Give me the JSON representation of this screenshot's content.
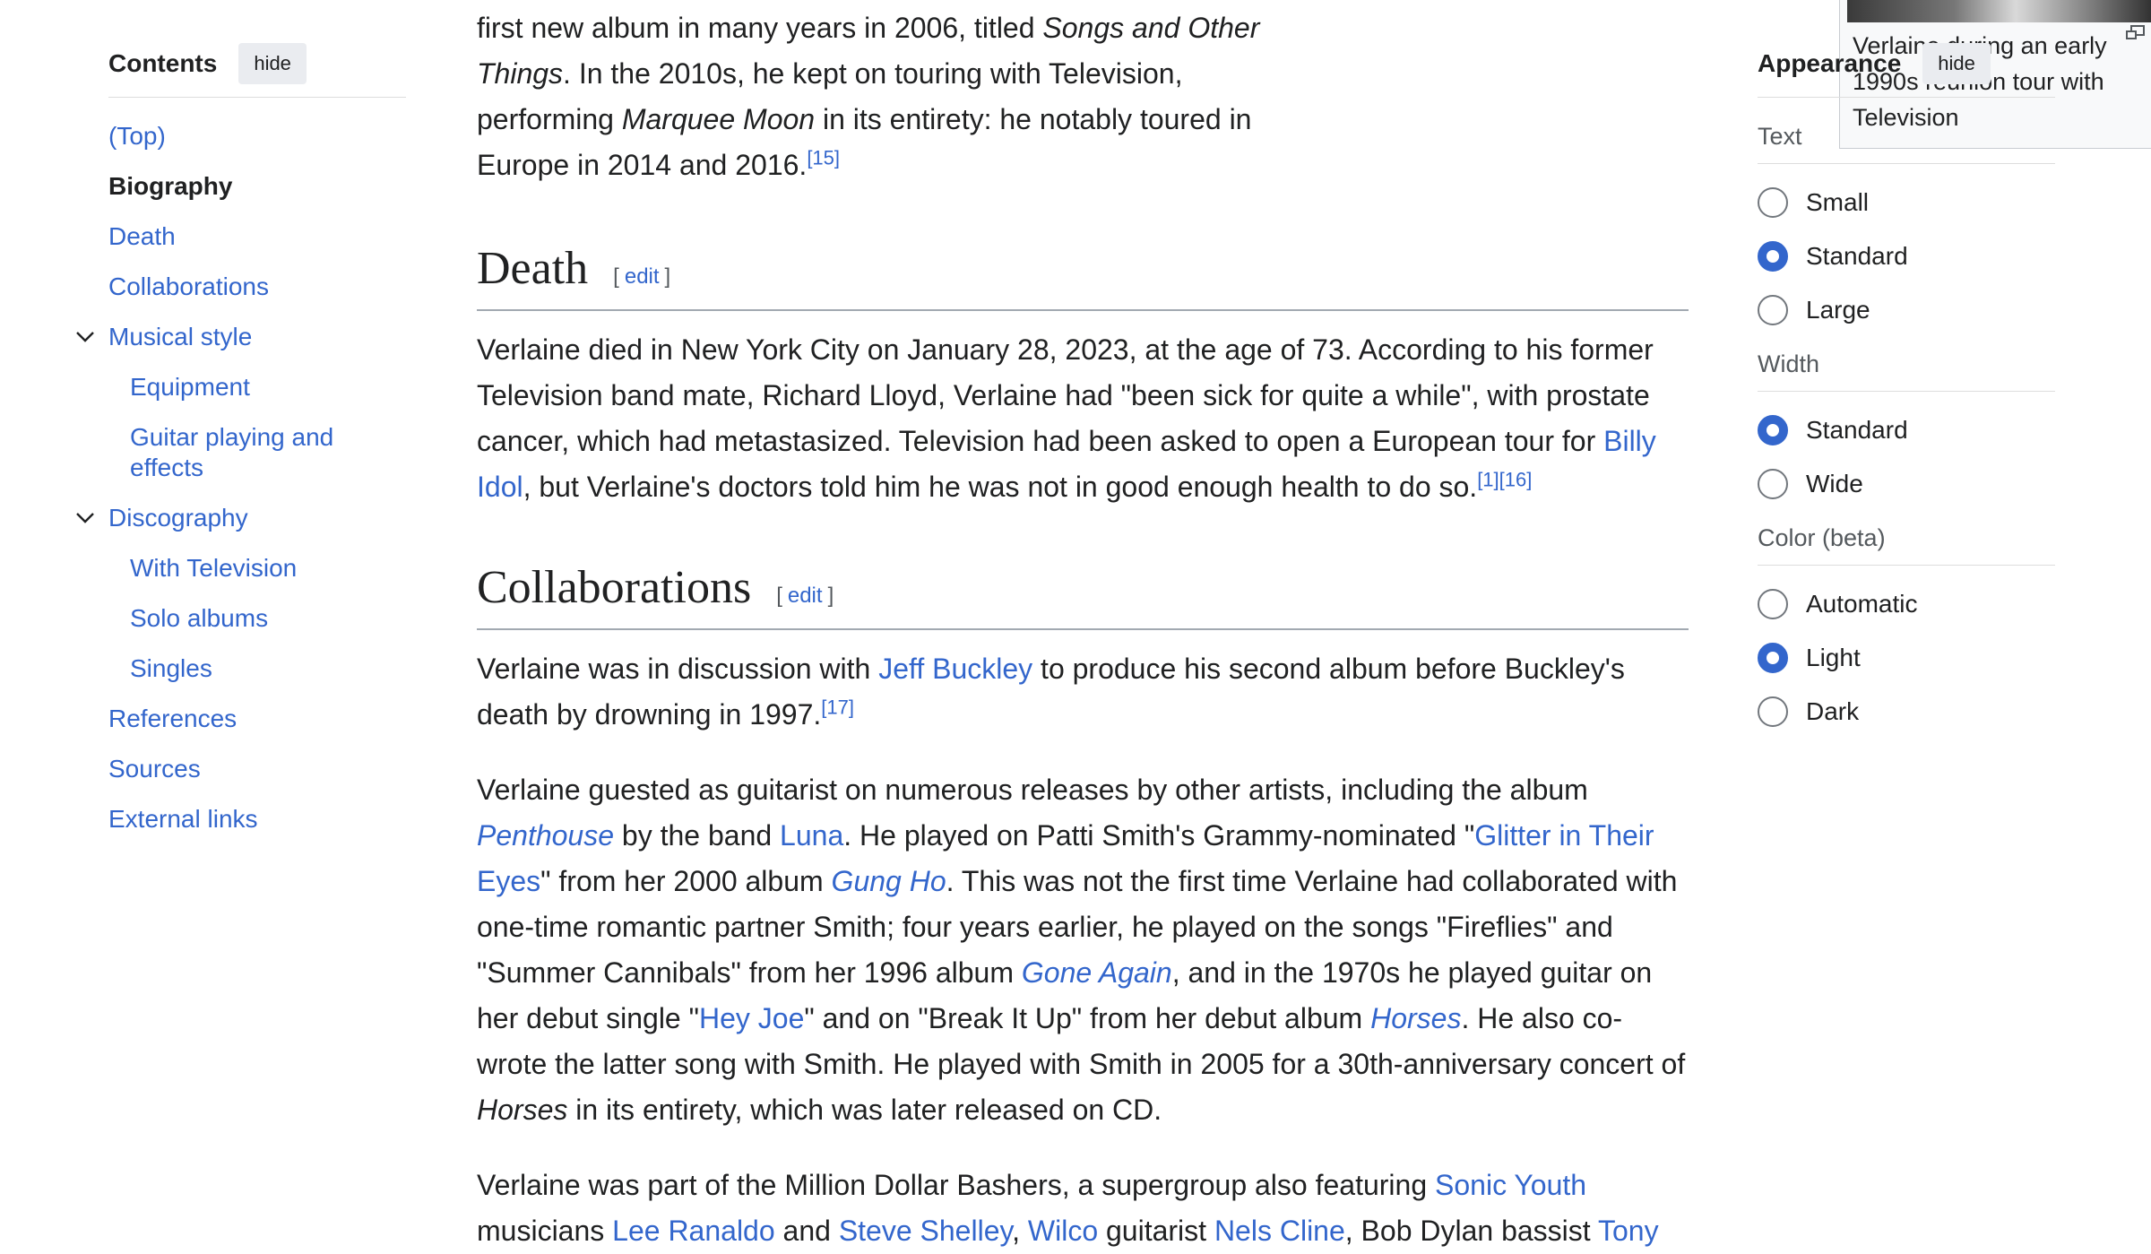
{
  "toc": {
    "title": "Contents",
    "hide": "hide",
    "items": [
      {
        "label": "(Top)"
      },
      {
        "label": "Biography"
      },
      {
        "label": "Death"
      },
      {
        "label": "Collaborations"
      },
      {
        "label": "Musical style"
      },
      {
        "label": "Equipment"
      },
      {
        "label": "Guitar playing and effects"
      },
      {
        "label": "Discography"
      },
      {
        "label": "With Television"
      },
      {
        "label": "Solo albums"
      },
      {
        "label": "Singles"
      },
      {
        "label": "References"
      },
      {
        "label": "Sources"
      },
      {
        "label": "External links"
      }
    ]
  },
  "article": {
    "intro": {
      "t1": "first new album in many years in 2006, titled ",
      "i1": "Songs and Other Things",
      "t2": ". In the 2010s, he kept on touring with Television, performing ",
      "i2": "Marquee Moon",
      "t3": " in its entirety: he notably toured in Europe in 2014 and 2016.",
      "ref": "[15]"
    },
    "figure_caption": "Verlaine during an early 1990s reunion tour with Television",
    "death": {
      "heading": "Death",
      "edit": "edit",
      "t1": "Verlaine died in New York City on January 28, 2023, at the age of 73. According to his former Television band mate, Richard Lloyd, Verlaine had \"been sick for quite a while\", with prostate cancer, which had metastasized. Television had been asked to open a European tour for ",
      "l1": "Billy Idol",
      "t2": ", but Verlaine's doctors told him he was not in good enough health to do so.",
      "ref1": "[1]",
      "ref2": "[16]"
    },
    "collab": {
      "heading": "Collaborations",
      "edit": "edit",
      "p1": {
        "t1": "Verlaine was in discussion with ",
        "l1": "Jeff Buckley",
        "t2": " to produce his second album before Buckley's death by drowning in 1997.",
        "ref": "[17]"
      },
      "p2": {
        "t1": "Verlaine guested as guitarist on numerous releases by other artists, including the album ",
        "li1": "Penthouse",
        "t2": " by the band ",
        "l1": "Luna",
        "t3": ". He played on Patti Smith's Grammy-nominated \"",
        "l2": "Glitter in Their Eyes",
        "t4": "\" from her 2000 album ",
        "li2": "Gung Ho",
        "t5": ". This was not the first time Verlaine had collaborated with one-time romantic partner Smith; four years earlier, he played on the songs \"Fireflies\" and \"Summer Cannibals\" from her 1996 album ",
        "li3": "Gone Again",
        "t6": ", and in the 1970s he played guitar on her debut single \"",
        "l3": "Hey Joe",
        "t7": "\" and on \"Break It Up\" from her debut album ",
        "li4": "Horses",
        "t8": ". He also co-wrote the latter song with Smith. He played with Smith in 2005 for a 30th-anniversary concert of ",
        "i1": "Horses",
        "t9": " in its entirety, which was later released on CD."
      },
      "p3": {
        "t1": "Verlaine was part of the Million Dollar Bashers, a supergroup also featuring ",
        "l1": "Sonic Youth",
        "t2": " musicians ",
        "l2": "Lee Ranaldo",
        "t3": " and ",
        "l3": "Steve Shelley",
        "t4": ", ",
        "l4": "Wilco",
        "t5": " guitarist ",
        "l5": "Nels Cline",
        "t6": ", Bob Dylan bassist ",
        "l6": "Tony"
      }
    }
  },
  "appearance": {
    "title": "Appearance",
    "hide": "hide",
    "text": {
      "label": "Text",
      "options": [
        "Small",
        "Standard",
        "Large"
      ],
      "selected": "Standard"
    },
    "width": {
      "label": "Width",
      "options": [
        "Standard",
        "Wide"
      ],
      "selected": "Standard"
    },
    "color": {
      "label": "Color (beta)",
      "options": [
        "Automatic",
        "Light",
        "Dark"
      ],
      "selected": "Light"
    }
  },
  "colors": {
    "link": "#3366cc",
    "text": "#202122",
    "radio_checked": "#3366cc"
  }
}
